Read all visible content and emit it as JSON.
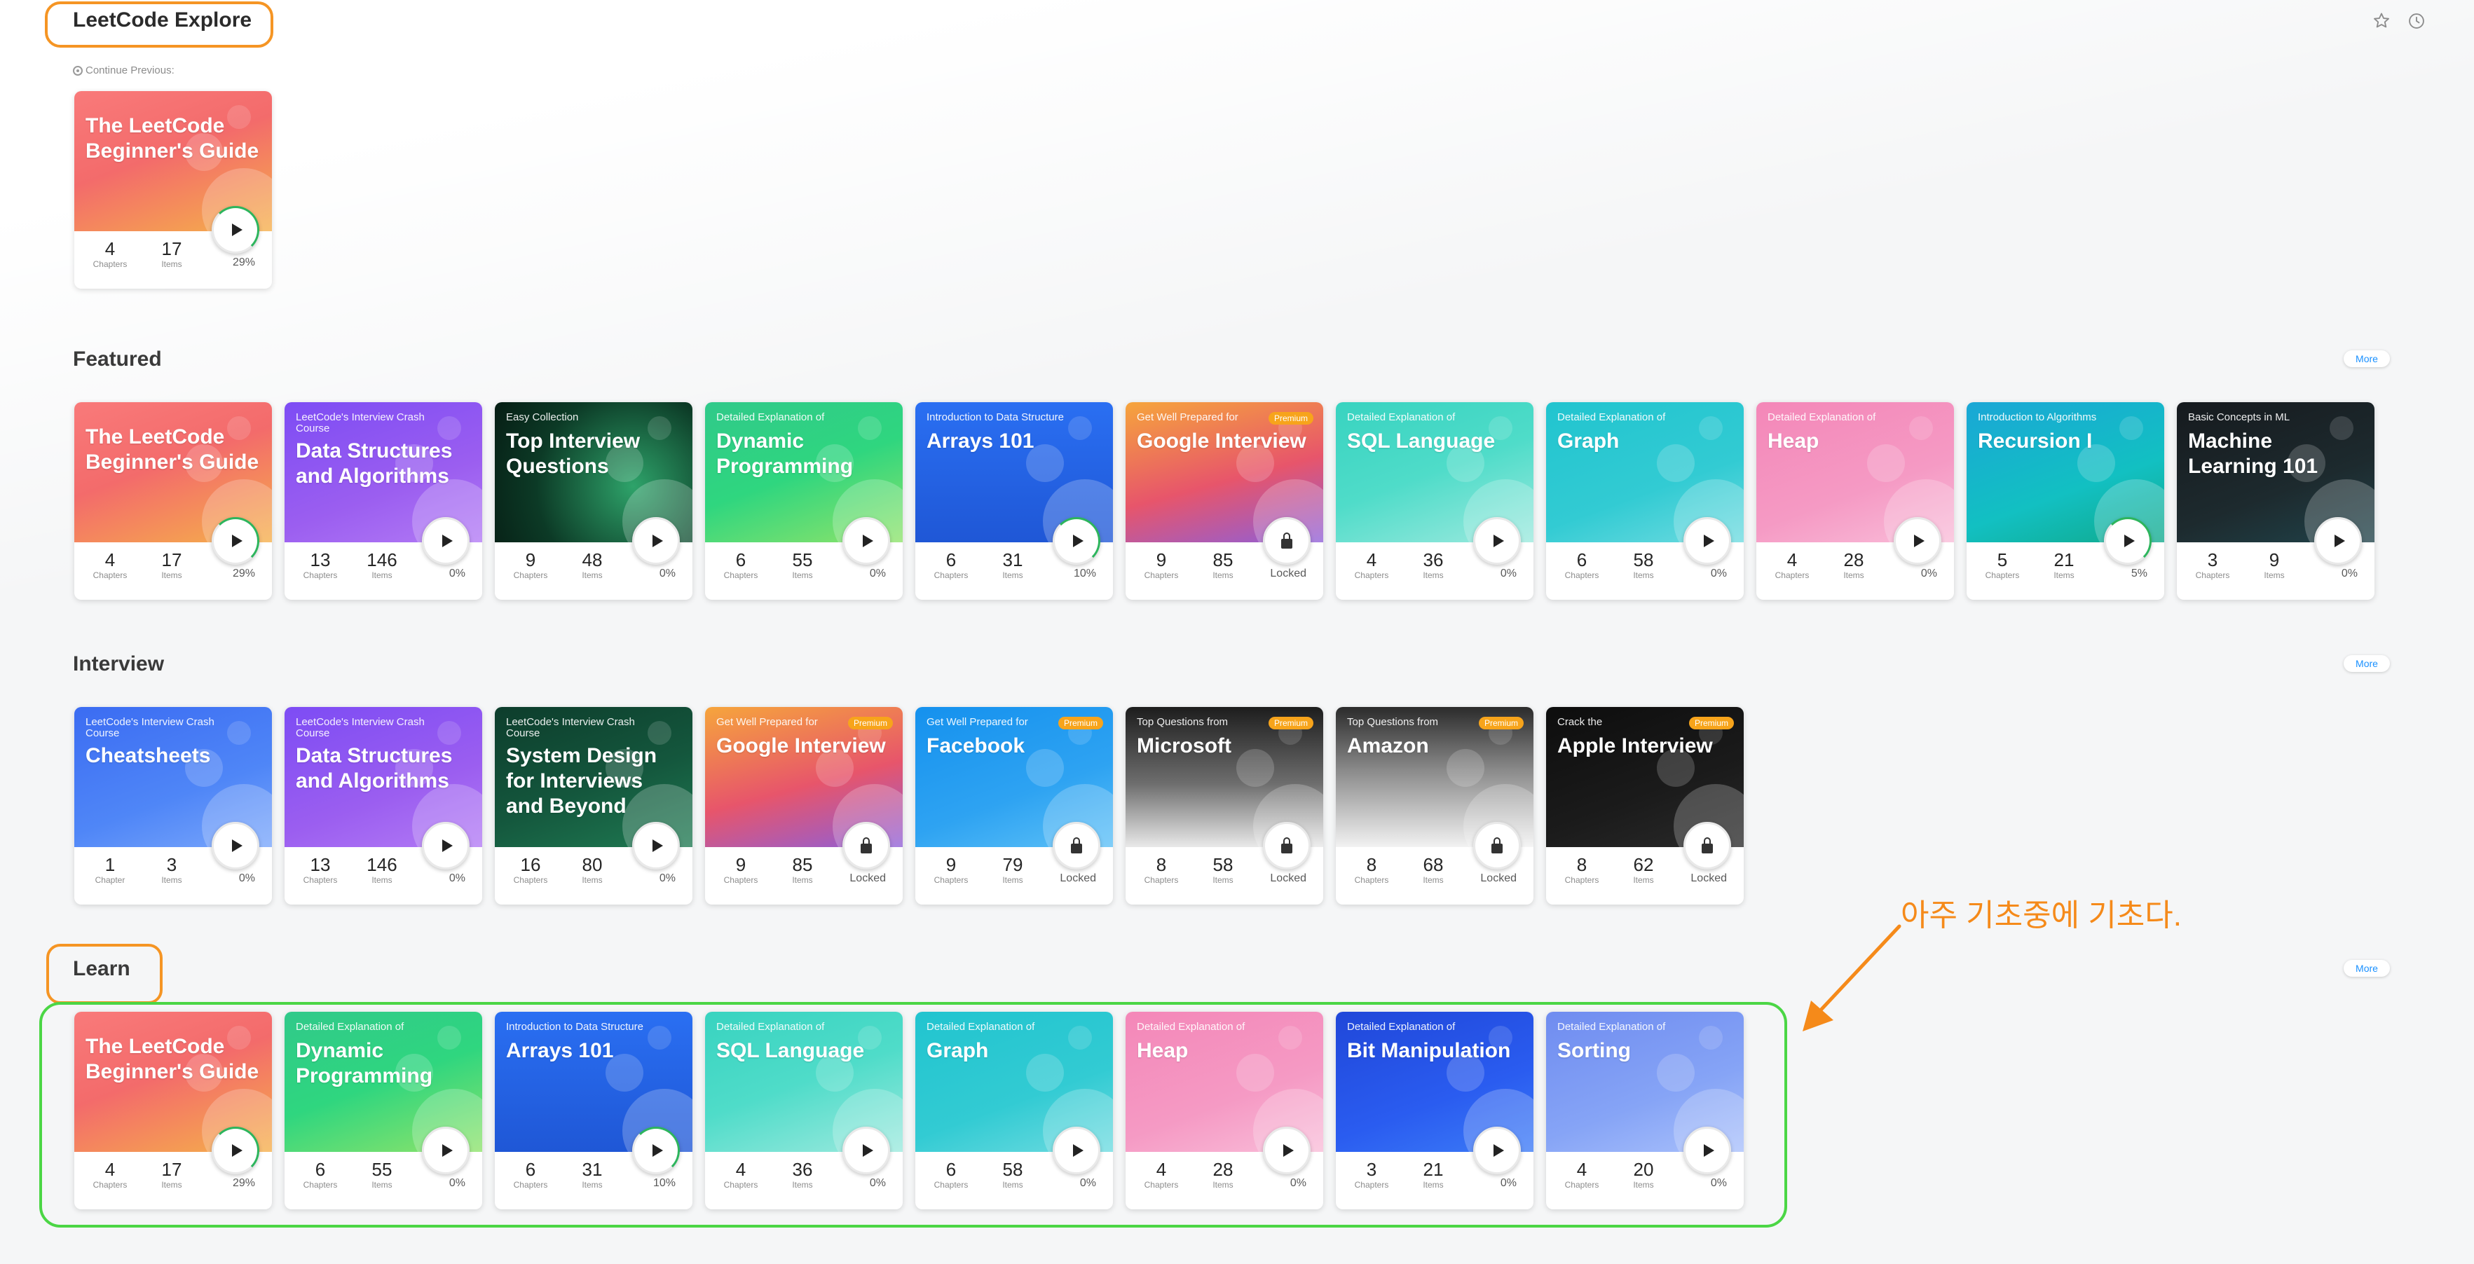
{
  "header": {
    "title": "LeetCode Explore",
    "icons": [
      "star-icon",
      "history-icon"
    ]
  },
  "continue_label": "Continue Previous:",
  "continue_card": {
    "subtitle": "",
    "title": "The LeetCode Beginner's Guide",
    "chapters": "4",
    "chapters_label": "Chapters",
    "items": "17",
    "items_label": "Items",
    "status": "29%",
    "premium": false,
    "locked": false,
    "progress": 0.29,
    "bg": "linear-gradient(160deg,#f97a7a,#f36b6b 45%,#f5b04a)"
  },
  "sections": [
    {
      "title": "Featured",
      "more_label": "More",
      "cards": [
        {
          "subtitle": "",
          "title": "The LeetCode Beginner's Guide",
          "chapters": "4",
          "chapters_label": "Chapters",
          "items": "17",
          "items_label": "Items",
          "status": "29%",
          "premium": false,
          "locked": false,
          "progress": 0.29,
          "bg": "linear-gradient(160deg,#f97a7a,#f36b6b 45%,#f5b04a)"
        },
        {
          "subtitle": "LeetCode's Interview Crash Course",
          "title": "Data Structures and Algorithms",
          "chapters": "13",
          "chapters_label": "Chapters",
          "items": "146",
          "items_label": "Items",
          "status": "0%",
          "premium": false,
          "locked": false,
          "progress": 0,
          "bg": "linear-gradient(160deg,#7d4cf4,#9b5ef0 60%,#b27af5)"
        },
        {
          "subtitle": "Easy Collection",
          "title": "Top Interview Questions",
          "chapters": "9",
          "chapters_label": "Chapters",
          "items": "48",
          "items_label": "Items",
          "status": "0%",
          "premium": false,
          "locked": false,
          "progress": 0,
          "bg": "radial-gradient(circle at 70% 60%,#2ea36a,#0c3a26 60%,#061d14)"
        },
        {
          "subtitle": "Detailed Explanation of",
          "title": "Dynamic Programming",
          "chapters": "6",
          "chapters_label": "Chapters",
          "items": "55",
          "items_label": "Items",
          "status": "0%",
          "premium": false,
          "locked": false,
          "progress": 0,
          "bg": "linear-gradient(160deg,#30c98a,#2fd67f 50%,#8fe36a)"
        },
        {
          "subtitle": "Introduction to Data Structure",
          "title": "Arrays 101",
          "chapters": "6",
          "chapters_label": "Chapters",
          "items": "31",
          "items_label": "Items",
          "status": "10%",
          "premium": false,
          "locked": false,
          "progress": 0.1,
          "bg": "linear-gradient(180deg,#2a6ff2,#1f57d6)"
        },
        {
          "subtitle": "Get Well Prepared for",
          "title": "Google Interview",
          "chapters": "9",
          "chapters_label": "Chapters",
          "items": "85",
          "items_label": "Items",
          "status": "Locked",
          "premium": true,
          "premium_label": "Premium",
          "locked": true,
          "progress": 0,
          "bg": "linear-gradient(165deg,#f6a53c,#e7556b 55%,#8e5fd9)"
        },
        {
          "subtitle": "Detailed Explanation of",
          "title": "SQL Language",
          "chapters": "4",
          "chapters_label": "Chapters",
          "items": "36",
          "items_label": "Items",
          "status": "0%",
          "premium": false,
          "locked": false,
          "progress": 0,
          "bg": "linear-gradient(160deg,#38d3c0,#4fdcc9 50%,#9ce9de)"
        },
        {
          "subtitle": "Detailed Explanation of",
          "title": "Graph",
          "chapters": "6",
          "chapters_label": "Chapters",
          "items": "58",
          "items_label": "Items",
          "status": "0%",
          "premium": false,
          "locked": false,
          "progress": 0,
          "bg": "linear-gradient(160deg,#21c4cf,#32cbd3 60%,#6edbe0)"
        },
        {
          "subtitle": "Detailed Explanation of",
          "title": "Heap",
          "chapters": "4",
          "chapters_label": "Chapters",
          "items": "28",
          "items_label": "Items",
          "status": "0%",
          "premium": false,
          "locked": false,
          "progress": 0,
          "bg": "linear-gradient(160deg,#f487b8,#f59ac4 60%,#f9bdd9)"
        },
        {
          "subtitle": "Introduction to Algorithms",
          "title": "Recursion I",
          "chapters": "5",
          "chapters_label": "Chapters",
          "items": "21",
          "items_label": "Items",
          "status": "5%",
          "premium": false,
          "locked": false,
          "progress": 0.05,
          "bg": "linear-gradient(160deg,#1aa7d6,#12c0c2 60%,#10a98b)"
        },
        {
          "subtitle": "Basic Concepts in ML",
          "title": "Machine Learning 101",
          "chapters": "3",
          "chapters_label": "Chapters",
          "items": "9",
          "items_label": "Items",
          "status": "0%",
          "premium": false,
          "locked": false,
          "progress": 0,
          "bg": "linear-gradient(160deg,#161a1e,#1d2a2e 60%,#20434a)"
        }
      ]
    },
    {
      "title": "Interview",
      "more_label": "More",
      "cards": [
        {
          "subtitle": "LeetCode's Interview Crash Course",
          "title": "Cheatsheets",
          "chapters": "1",
          "chapters_label": "Chapter",
          "items": "3",
          "items_label": "Items",
          "status": "0%",
          "premium": false,
          "locked": false,
          "progress": 0,
          "bg": "linear-gradient(160deg,#3b6cf2,#4f86f7 60%,#79a6fb)"
        },
        {
          "subtitle": "LeetCode's Interview Crash Course",
          "title": "Data Structures and Algorithms",
          "chapters": "13",
          "chapters_label": "Chapters",
          "items": "146",
          "items_label": "Items",
          "status": "0%",
          "premium": false,
          "locked": false,
          "progress": 0,
          "bg": "linear-gradient(160deg,#7d4cf4,#9b5ef0 60%,#b27af5)"
        },
        {
          "subtitle": "LeetCode's Interview Crash Course",
          "title": "System Design for Interviews and Beyond",
          "chapters": "16",
          "chapters_label": "Chapters",
          "items": "80",
          "items_label": "Items",
          "status": "0%",
          "premium": false,
          "locked": false,
          "progress": 0,
          "bg": "linear-gradient(160deg,#0d3d2c,#14573d 55%,#1f7a52)"
        },
        {
          "subtitle": "Get Well Prepared for",
          "title": "Google Interview",
          "chapters": "9",
          "chapters_label": "Chapters",
          "items": "85",
          "items_label": "Items",
          "status": "Locked",
          "premium": true,
          "premium_label": "Premium",
          "locked": true,
          "progress": 0,
          "bg": "linear-gradient(165deg,#f6a53c,#e7556b 55%,#8e5fd9)"
        },
        {
          "subtitle": "Get Well Prepared for",
          "title": "Facebook",
          "chapters": "9",
          "chapters_label": "Chapters",
          "items": "79",
          "items_label": "Items",
          "status": "Locked",
          "premium": true,
          "premium_label": "Premium",
          "locked": true,
          "progress": 0,
          "bg": "linear-gradient(160deg,#1591ee,#2ea3f2 60%,#5cc0f7)"
        },
        {
          "subtitle": "Top Questions from",
          "title": "Microsoft",
          "chapters": "8",
          "chapters_label": "Chapters",
          "items": "58",
          "items_label": "Items",
          "status": "Locked",
          "premium": true,
          "premium_label": "Premium",
          "locked": true,
          "progress": 0,
          "bg": "linear-gradient(180deg,#1d1d1d,#6e6e6e 55%,#e9e9e9)"
        },
        {
          "subtitle": "Top Questions from",
          "title": "Amazon",
          "chapters": "8",
          "chapters_label": "Chapters",
          "items": "68",
          "items_label": "Items",
          "status": "Locked",
          "premium": true,
          "premium_label": "Premium",
          "locked": true,
          "progress": 0,
          "bg": "linear-gradient(180deg,#2b2b2b,#8a8a8a 45%,#f2f2f2)"
        },
        {
          "subtitle": "Crack the",
          "title": "Apple Interview",
          "chapters": "8",
          "chapters_label": "Chapters",
          "items": "62",
          "items_label": "Items",
          "status": "Locked",
          "premium": true,
          "premium_label": "Premium",
          "locked": true,
          "progress": 0,
          "bg": "linear-gradient(160deg,#0d0d0d,#1b1b1b 60%,#2a2a2a)"
        }
      ]
    },
    {
      "title": "Learn",
      "more_label": "More",
      "cards": [
        {
          "subtitle": "",
          "title": "The LeetCode Beginner's Guide",
          "chapters": "4",
          "chapters_label": "Chapters",
          "items": "17",
          "items_label": "Items",
          "status": "29%",
          "premium": false,
          "locked": false,
          "progress": 0.29,
          "bg": "linear-gradient(160deg,#f97a7a,#f36b6b 45%,#f5b04a)"
        },
        {
          "subtitle": "Detailed Explanation of",
          "title": "Dynamic Programming",
          "chapters": "6",
          "chapters_label": "Chapters",
          "items": "55",
          "items_label": "Items",
          "status": "0%",
          "premium": false,
          "locked": false,
          "progress": 0,
          "bg": "linear-gradient(160deg,#30c98a,#2fd67f 50%,#8fe36a)"
        },
        {
          "subtitle": "Introduction to Data Structure",
          "title": "Arrays 101",
          "chapters": "6",
          "chapters_label": "Chapters",
          "items": "31",
          "items_label": "Items",
          "status": "10%",
          "premium": false,
          "locked": false,
          "progress": 0.1,
          "bg": "linear-gradient(180deg,#2a6ff2,#1f57d6)"
        },
        {
          "subtitle": "Detailed Explanation of",
          "title": "SQL Language",
          "chapters": "4",
          "chapters_label": "Chapters",
          "items": "36",
          "items_label": "Items",
          "status": "0%",
          "premium": false,
          "locked": false,
          "progress": 0,
          "bg": "linear-gradient(160deg,#38d3c0,#4fdcc9 50%,#9ce9de)"
        },
        {
          "subtitle": "Detailed Explanation of",
          "title": "Graph",
          "chapters": "6",
          "chapters_label": "Chapters",
          "items": "58",
          "items_label": "Items",
          "status": "0%",
          "premium": false,
          "locked": false,
          "progress": 0,
          "bg": "linear-gradient(160deg,#21c4cf,#32cbd3 60%,#6edbe0)"
        },
        {
          "subtitle": "Detailed Explanation of",
          "title": "Heap",
          "chapters": "4",
          "chapters_label": "Chapters",
          "items": "28",
          "items_label": "Items",
          "status": "0%",
          "premium": false,
          "locked": false,
          "progress": 0,
          "bg": "linear-gradient(160deg,#f487b8,#f59ac4 60%,#f9bdd9)"
        },
        {
          "subtitle": "Detailed Explanation of",
          "title": "Bit Manipulation",
          "chapters": "3",
          "chapters_label": "Chapters",
          "items": "21",
          "items_label": "Items",
          "status": "0%",
          "premium": false,
          "locked": false,
          "progress": 0,
          "bg": "linear-gradient(160deg,#2047d9,#2a5cf0 60%,#3c7bf7)"
        },
        {
          "subtitle": "Detailed Explanation of",
          "title": "Sorting",
          "chapters": "4",
          "chapters_label": "Chapters",
          "items": "20",
          "items_label": "Items",
          "status": "0%",
          "premium": false,
          "locked": false,
          "progress": 0,
          "bg": "linear-gradient(160deg,#6f8cf0,#86a4f6 60%,#a9c0fb)"
        }
      ]
    }
  ],
  "annotation": "아주 기초중에 기초다.",
  "annotation_color": "#f58a1a",
  "highlight_colors": {
    "orange": "#f59524",
    "green": "#4bd645"
  }
}
